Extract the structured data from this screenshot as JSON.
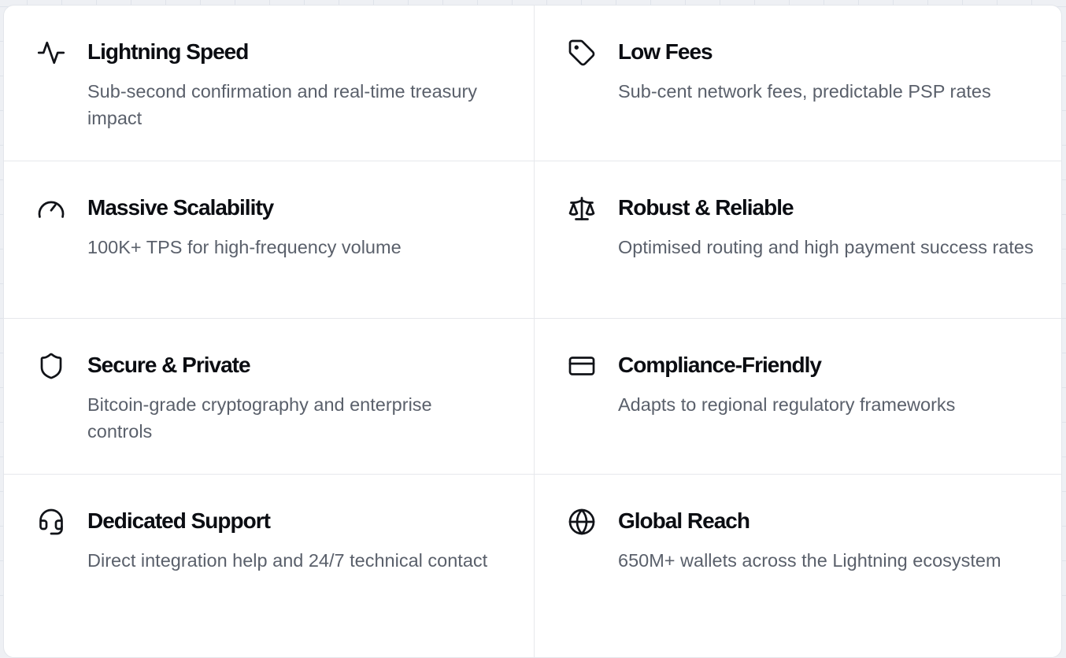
{
  "features": [
    {
      "title": "Lightning Speed",
      "description": "Sub-second confirmation and real-time treasury impact",
      "icon": "activity-pulse-icon"
    },
    {
      "title": "Low Fees",
      "description": "Sub-cent network fees, predictable PSP rates",
      "icon": "tag-icon"
    },
    {
      "title": "Massive Scalability",
      "description": "100K+ TPS for high-frequency volume",
      "icon": "gauge-icon"
    },
    {
      "title": "Robust & Reliable",
      "description": "Optimised routing and high payment success rates",
      "icon": "scale-icon"
    },
    {
      "title": "Secure & Private",
      "description": "Bitcoin-grade cryptography and enterprise controls",
      "icon": "shield-icon"
    },
    {
      "title": "Compliance-Friendly",
      "description": "Adapts to regional regulatory frameworks",
      "icon": "credit-card-icon"
    },
    {
      "title": "Dedicated Support",
      "description": "Direct integration help and 24/7 technical contact",
      "icon": "headset-icon"
    },
    {
      "title": "Global Reach",
      "description": "650M+ wallets across the Lightning ecosystem",
      "icon": "globe-icon"
    }
  ],
  "colors": {
    "title": "#0b0d12",
    "description": "#5a606b",
    "icon_stroke": "#111318",
    "divider": "#e6e8ec"
  }
}
